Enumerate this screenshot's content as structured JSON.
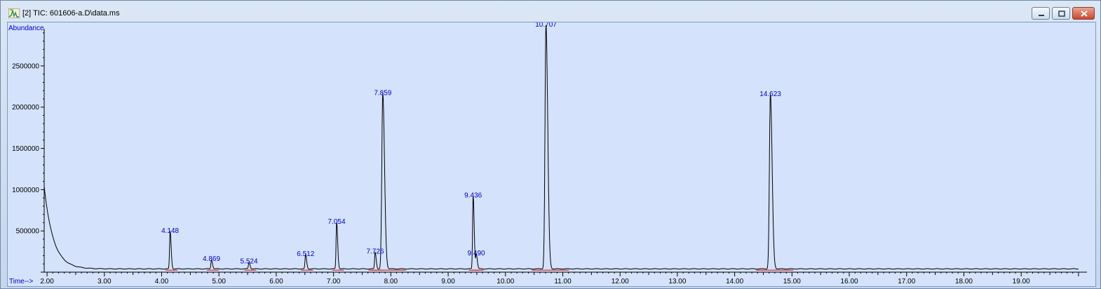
{
  "window": {
    "title": "[2] TIC: 601606-a.D\\data.ms",
    "controls": [
      "minimize",
      "maximize",
      "close"
    ]
  },
  "chart_data": {
    "type": "line",
    "title": "",
    "ylabel": "Abundance",
    "xlabel": "Time-->",
    "xlim": [
      1.95,
      20.05
    ],
    "ylim": [
      0,
      2950000
    ],
    "x_ticks": [
      2,
      3,
      4,
      5,
      6,
      7,
      8,
      9,
      10,
      11,
      12,
      13,
      14,
      15,
      16,
      17,
      18,
      19
    ],
    "x_tick_labels": [
      "2.00",
      "3.00",
      "4.00",
      "5.00",
      "6.00",
      "7.00",
      "8.00",
      "9.00",
      "10.00",
      "11.00",
      "12.00",
      "13.00",
      "14.00",
      "15.00",
      "16.00",
      "17.00",
      "18.00",
      "19.00"
    ],
    "y_ticks": [
      500000,
      1000000,
      1500000,
      2000000,
      2500000
    ],
    "y_tick_labels": [
      "500000",
      "1000000",
      "1500000",
      "2000000",
      "2500000"
    ],
    "initial_signal": {
      "start": 1040000,
      "baseline": 40000
    },
    "peaks": [
      {
        "rt": 4.148,
        "label": "4.148",
        "height": 450000
      },
      {
        "rt": 4.869,
        "label": "4.869",
        "height": 110000
      },
      {
        "rt": 5.524,
        "label": "5.524",
        "height": 80000
      },
      {
        "rt": 6.512,
        "label": "6.512",
        "height": 170000
      },
      {
        "rt": 7.054,
        "label": "7.054",
        "height": 560000
      },
      {
        "rt": 7.726,
        "label": "7.726",
        "height": 200000
      },
      {
        "rt": 7.859,
        "label": "7.859",
        "height": 2120000
      },
      {
        "rt": 9.436,
        "label": "9.436",
        "height": 880000
      },
      {
        "rt": 9.49,
        "label": "9.490",
        "height": 180000
      },
      {
        "rt": 10.707,
        "label": "10.707",
        "height": 2950000
      },
      {
        "rt": 14.623,
        "label": "14.623",
        "height": 2110000
      }
    ],
    "colors": {
      "background": "#d4e2fb",
      "trace": "#000000",
      "labels": "#0000cc",
      "integration": "#e00000"
    },
    "grid": false,
    "legend": "none"
  }
}
